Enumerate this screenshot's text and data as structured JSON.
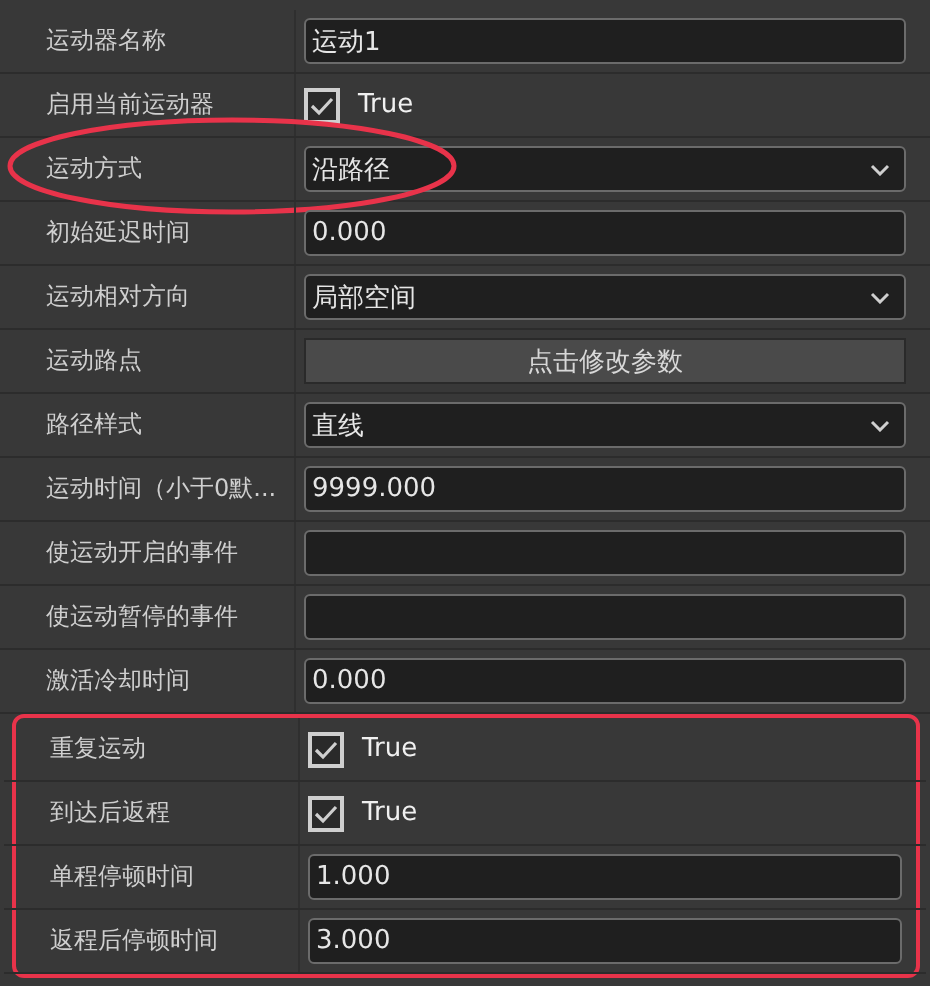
{
  "sections": [
    {
      "outlined": false,
      "rows": [
        {
          "label": "运动器名称",
          "kind": "text",
          "value": "运动1",
          "circled": false
        },
        {
          "label": "启用当前运动器",
          "kind": "checkbox",
          "checked": true,
          "value": "True",
          "circled": false
        },
        {
          "label": "运动方式",
          "kind": "dropdown",
          "value": "沿路径",
          "circled": true
        },
        {
          "label": "初始延迟时间",
          "kind": "text",
          "value": "0.000",
          "circled": false
        },
        {
          "label": "运动相对方向",
          "kind": "dropdown",
          "value": "局部空间",
          "circled": false
        },
        {
          "label": "运动路点",
          "kind": "button",
          "value": "点击修改参数",
          "circled": false
        },
        {
          "label": "路径样式",
          "kind": "dropdown",
          "value": "直线",
          "circled": false
        },
        {
          "label": "运动时间（小于0默...",
          "kind": "text",
          "value": "9999.000",
          "circled": false
        },
        {
          "label": "使运动开启的事件",
          "kind": "text",
          "circled": false
        },
        {
          "label": "使运动暂停的事件",
          "kind": "text",
          "circled": false
        },
        {
          "label": "激活冷却时间",
          "kind": "text",
          "value": "0.000",
          "circled": false
        }
      ]
    },
    {
      "outlined": true,
      "rows": [
        {
          "label": "重复运动",
          "kind": "checkbox",
          "checked": true,
          "value": "True",
          "circled": false
        },
        {
          "label": "到达后返程",
          "kind": "checkbox",
          "checked": true,
          "value": "True",
          "circled": false
        },
        {
          "label": "单程停顿时间",
          "kind": "text",
          "value": "1.000",
          "circled": false
        },
        {
          "label": "返程后停顿时间",
          "kind": "text",
          "value": "3.000",
          "circled": false
        }
      ]
    }
  ]
}
